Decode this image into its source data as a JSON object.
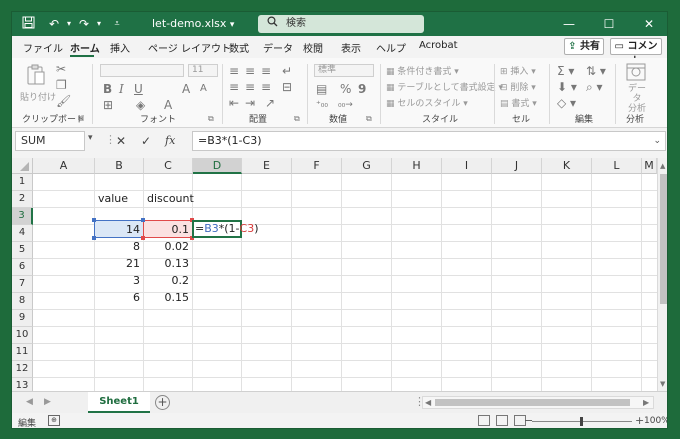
{
  "title_bar": {
    "filename": "let-demo.xlsx",
    "filename_caret": "▾",
    "search_placeholder": "検索",
    "icons": [
      "save-icon",
      "undo-icon",
      "redo-icon",
      "customize-qat-icon",
      "search-icon",
      "minimize-icon",
      "maximize-icon",
      "close-icon"
    ]
  },
  "ribbon_tabs": [
    "ファイル",
    "ホーム",
    "挿入",
    "ページ レイアウト",
    "数式",
    "データ",
    "校閲",
    "表示",
    "ヘルプ",
    "Acrobat"
  ],
  "active_tab": "ホーム",
  "share_label": "共有",
  "comment_label": "コメント",
  "ribbon": {
    "clipboard": {
      "paste": "貼り付け",
      "label": "クリップボード"
    },
    "font": {
      "size": "11",
      "label": "フォント"
    },
    "alignment": {
      "label": "配置"
    },
    "number": {
      "format": "標準",
      "label": "数値"
    },
    "styles": {
      "conditional": "条件付き書式",
      "as_table": "テーブルとして書式設定",
      "cell_styles": "セルのスタイル",
      "label": "スタイル"
    },
    "cells": {
      "insert": "挿入",
      "delete": "削除",
      "format": "書式",
      "label": "セル"
    },
    "editing": {
      "label": "編集"
    },
    "analysis": {
      "data_analysis": "データ\n分析",
      "label": "分析"
    }
  },
  "formula_bar": {
    "name_box": "SUM",
    "formula": "=B3*(1-C3)",
    "cancel_glyph": "✕",
    "enter_glyph": "✓",
    "fx_glyph": "fx"
  },
  "grid": {
    "columns": [
      "A",
      "B",
      "C",
      "D",
      "E",
      "F",
      "G",
      "H",
      "I",
      "J",
      "K",
      "L",
      "M"
    ],
    "selected_column": "D",
    "rows": [
      "1",
      "2",
      "3",
      "4",
      "5",
      "6",
      "7",
      "8",
      "9",
      "10",
      "11",
      "12",
      "13"
    ],
    "selected_row": "3",
    "headers": {
      "B2": "value",
      "C2": "discount"
    },
    "values": {
      "B": [
        "14",
        "8",
        "21",
        "3",
        "6"
      ],
      "C": [
        "0.1",
        "0.02",
        "0.13",
        "0.2",
        "0.15"
      ]
    },
    "edit_parts": {
      "eq": "=",
      "ref1": "B3",
      "mid": "*(1-",
      "ref2": "C3",
      "end": ")"
    }
  },
  "sheet_tabs": {
    "active": "Sheet1",
    "add_glyph": "+"
  },
  "status_bar": {
    "mode": "編集",
    "zoom": "100%",
    "zoom_minus": "−",
    "zoom_plus": "+"
  },
  "colors": {
    "excel_green": "#217346",
    "ref_blue": "#4472c4",
    "ref_red": "#e04a4a"
  }
}
